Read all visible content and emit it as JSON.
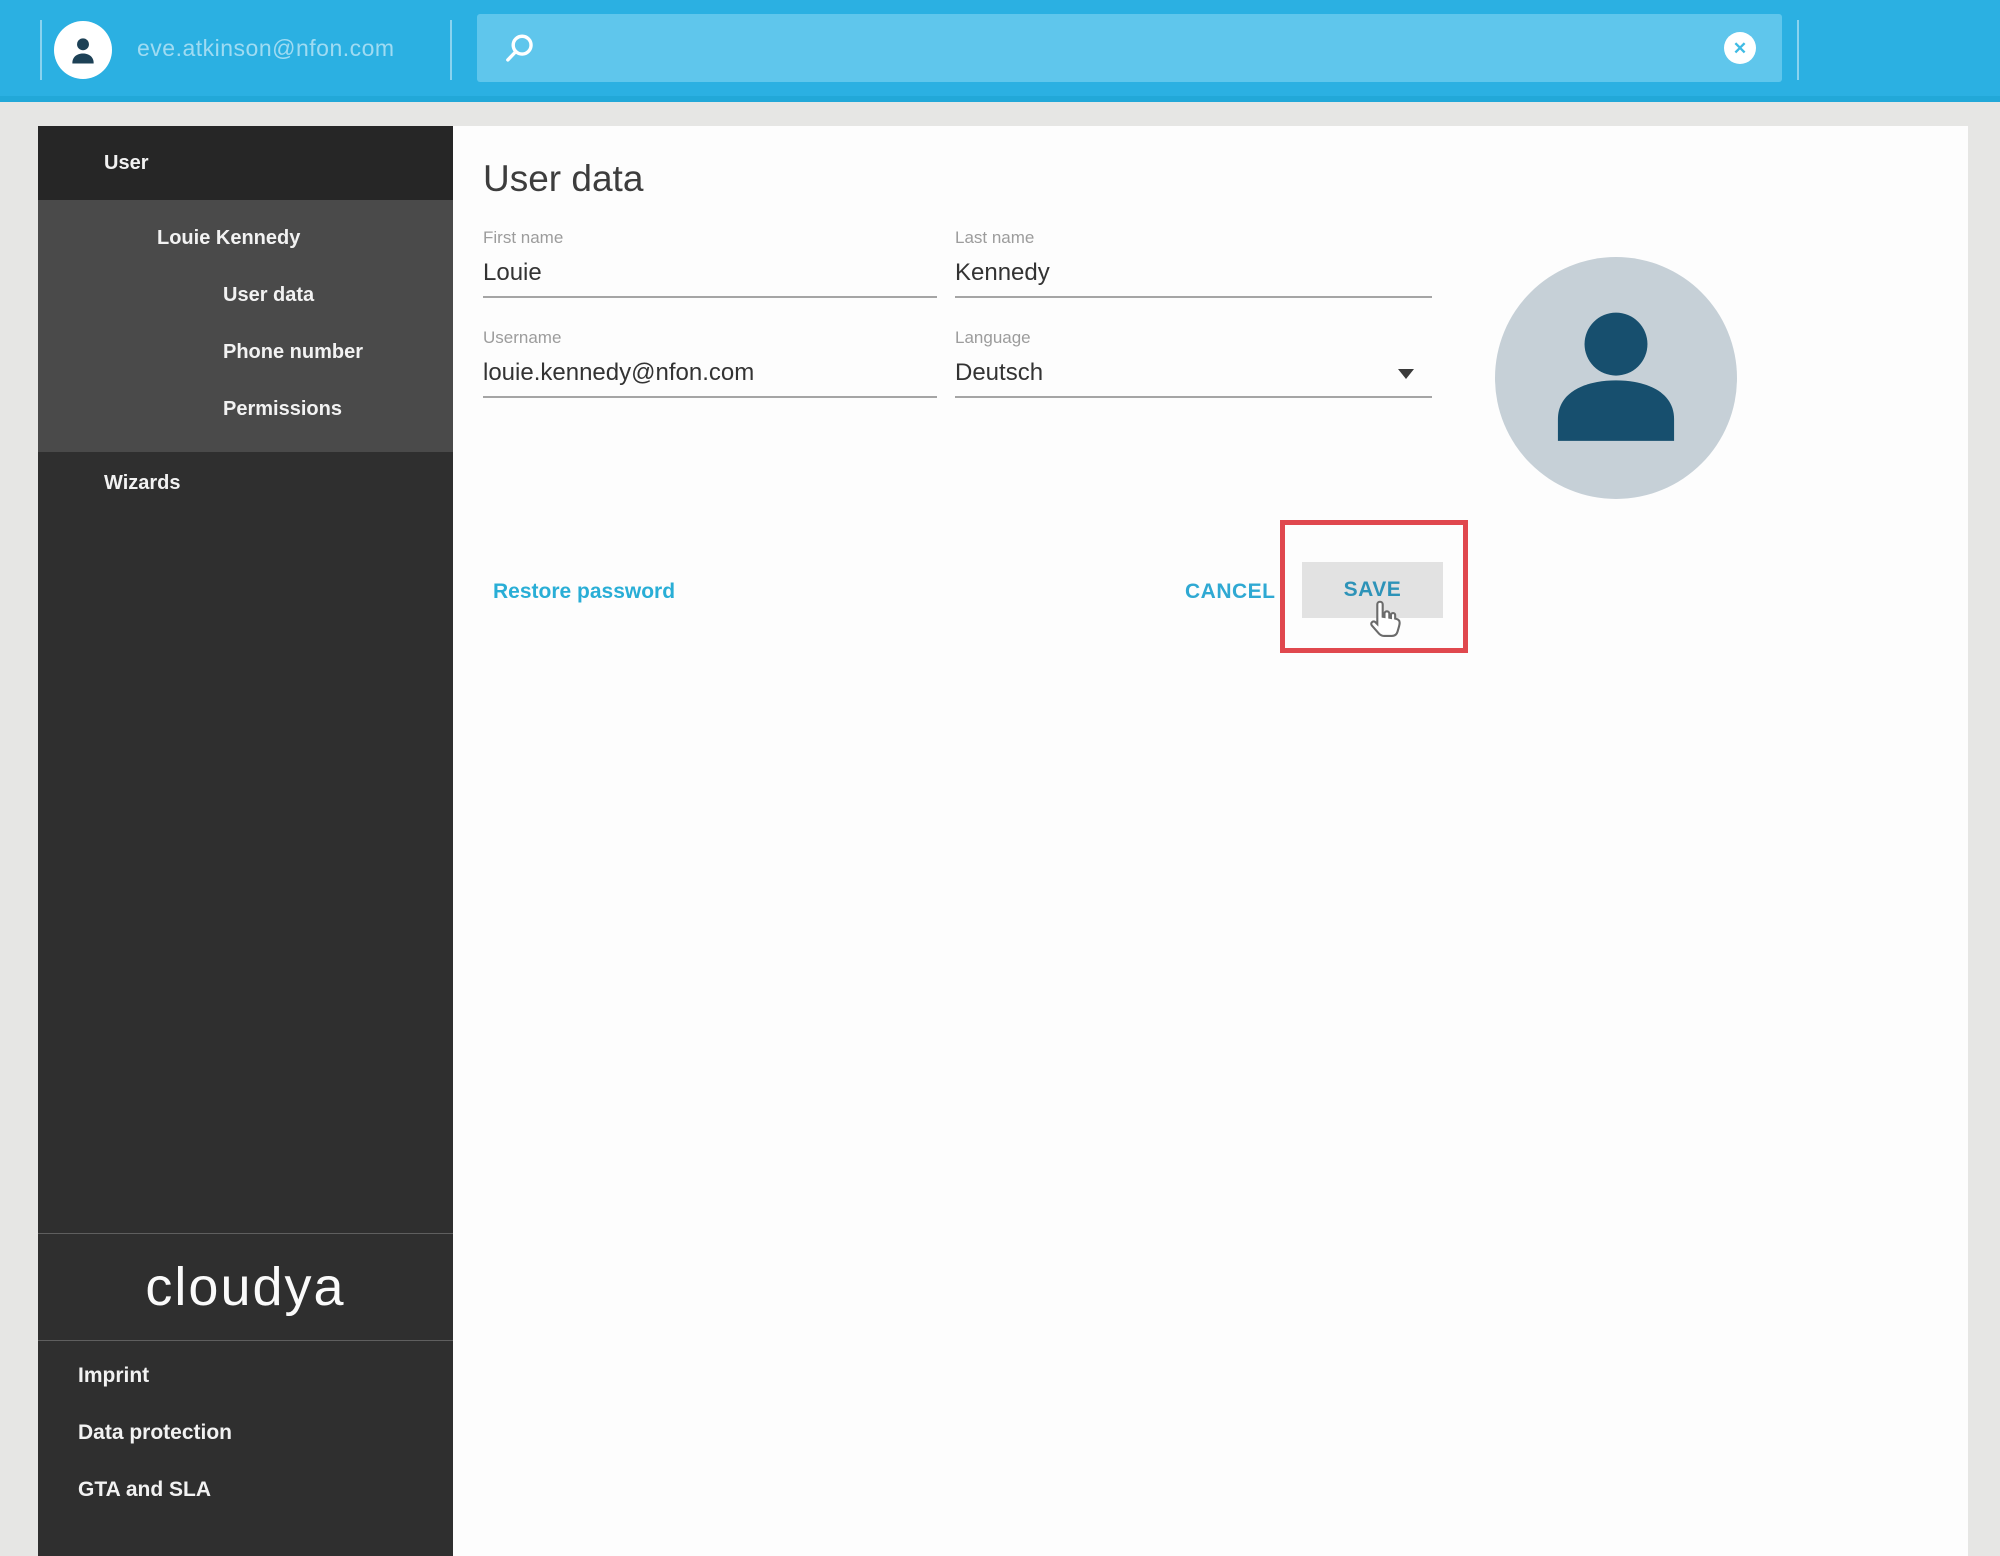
{
  "topbar": {
    "account_email": "eve.atkinson@nfon.com",
    "search_value": "",
    "clear_glyph": "✕"
  },
  "sidebar": {
    "nav": {
      "user": "User",
      "person": "Louie Kennedy",
      "user_data": "User data",
      "phone_number": "Phone number",
      "permissions": "Permissions",
      "wizards": "Wizards"
    },
    "logo": "cloudya",
    "footer": {
      "imprint": "Imprint",
      "data_protection": "Data protection",
      "gta_sla": "GTA and SLA"
    }
  },
  "main": {
    "title": "User data",
    "form": {
      "first_name_label": "First name",
      "first_name_value": "Louie",
      "last_name_label": "Last name",
      "last_name_value": "Kennedy",
      "username_label": "Username",
      "username_value": "louie.kennedy@nfon.com",
      "language_label": "Language",
      "language_value": "Deutsch"
    },
    "actions": {
      "restore_password": "Restore password",
      "cancel": "CANCEL",
      "save": "SAVE"
    }
  },
  "colors": {
    "topbar_cyan": "#2bb0e2",
    "search_box_cyan": "#5fc6ec",
    "sidebar_bg": "#2f2f2f",
    "sidebar_active_group": "#4a4a4a",
    "sidebar_top_item": "#262626",
    "link_cyan": "#29aed6",
    "save_teal": "#2d93b8",
    "annotation_red": "#e0484e",
    "avatar_circle": "#c6d0d7",
    "avatar_person": "#174f6e"
  }
}
